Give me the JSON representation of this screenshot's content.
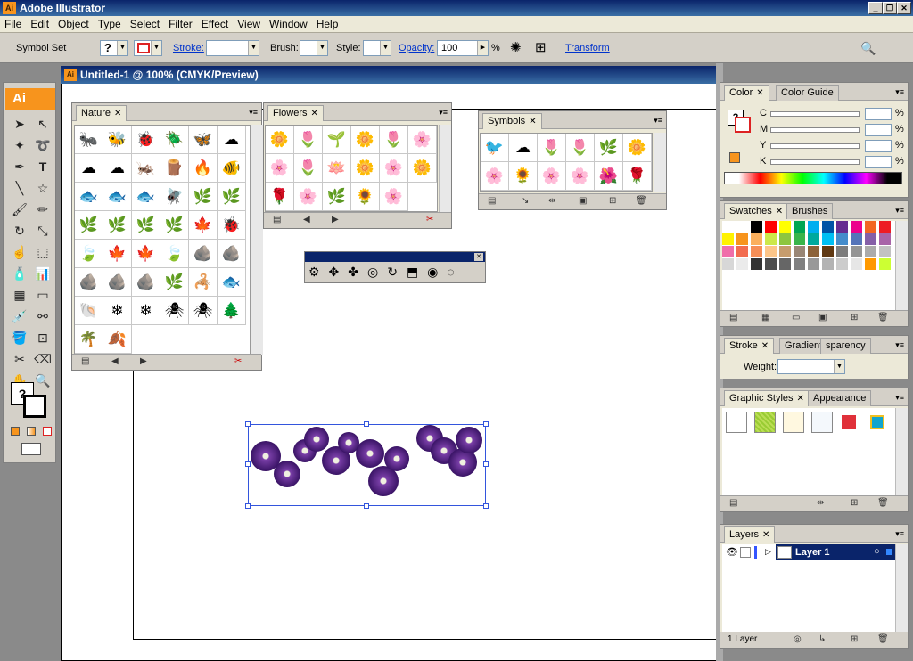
{
  "app": {
    "title": "Adobe Illustrator",
    "logo": "Ai",
    "win_min": "_",
    "win_max": "❐",
    "win_close": "✕"
  },
  "menus": [
    "File",
    "Edit",
    "Object",
    "Type",
    "Select",
    "Filter",
    "Effect",
    "View",
    "Window",
    "Help"
  ],
  "control": {
    "selection": "Symbol Set",
    "stroke_label": "Stroke:",
    "brush_label": "Brush:",
    "style_label": "Style:",
    "opacity_label": "Opacity:",
    "opacity_value": "100",
    "opacity_unit": "%",
    "transform_label": "Transform"
  },
  "document": {
    "title": "Untitled-1 @ 100% (CMYK/Preview)"
  },
  "nature": {
    "tab": "Nature",
    "icons": [
      "🐜",
      "🐝",
      "🐞",
      "🪲",
      "🦋",
      "☁",
      "☁",
      "☁",
      "🦗",
      "🪵",
      "🔥",
      "🐠",
      "🐟",
      "🐟",
      "🐟",
      "🪰",
      "🌿",
      "🌿",
      "🌿",
      "🌿",
      "🌿",
      "🌿",
      "🍁",
      "🐞",
      "🍃",
      "🍁",
      "🍁",
      "🍃",
      "🪨",
      "🪨",
      "🪨",
      "🪨",
      "🪨",
      "🌿",
      "🦂",
      "🐟",
      "🐚",
      "❄",
      "❄",
      "🕷",
      "🕷",
      "🌲",
      "🌴",
      "🍂"
    ]
  },
  "flowers": {
    "tab": "Flowers",
    "icons": [
      "🌼",
      "🌷",
      "🌱",
      "🌼",
      "🌷",
      "🌸",
      "🌸",
      "🌷",
      "🪷",
      "🌼",
      "🌸",
      "🌼",
      "🌹",
      "🌸",
      "🌿",
      "🌻",
      "🌸"
    ]
  },
  "symbols": {
    "tab": "Symbols",
    "icons": [
      "🐦",
      "☁",
      "🌷",
      "🌷",
      "🌿",
      "🌼",
      "🌸",
      "🌻",
      "🌸",
      "🌸",
      "🌺",
      "🌹"
    ]
  },
  "color": {
    "tab1": "Color",
    "tab2": "Color Guide",
    "labels": [
      "C",
      "M",
      "Y",
      "K"
    ],
    "unit": "%"
  },
  "swatches": {
    "tab1": "Swatches",
    "tab2": "Brushes",
    "colors": [
      "#ffffff",
      "#ffffff",
      "#000000",
      "#ff0000",
      "#ffff00",
      "#00a651",
      "#00aeef",
      "#0054a6",
      "#662d91",
      "#ec008c",
      "#f26522",
      "#ed1c24",
      "#fff200",
      "#f7941d",
      "#fbaf5d",
      "#cce84a",
      "#8dc63f",
      "#39b54a",
      "#00a99d",
      "#00bff3",
      "#448ccb",
      "#5574b9",
      "#855fa8",
      "#a864a8",
      "#f06eaa",
      "#f26c4f",
      "#f68e56",
      "#fdc689",
      "#c69c6d",
      "#998675",
      "#8c6239",
      "#603913",
      "#7d7d7d",
      "#959595",
      "#ababab",
      "#c2c2c2",
      "#d7d7d7",
      "#ebebeb",
      "#333333",
      "#4d4d4d",
      "#666666",
      "#808080",
      "#999999",
      "#b3b3b3",
      "#cccccc",
      "#e6e6e6",
      "#ff9900",
      "#ccff33"
    ]
  },
  "stroke": {
    "tab1": "Stroke",
    "tab2": "Gradient",
    "tab3": "sparency",
    "weight_label": "Weight:"
  },
  "graphic_styles": {
    "tab1": "Graphic Styles",
    "tab2": "Appearance"
  },
  "layers": {
    "tab": "Layers",
    "layer_name": "Layer 1",
    "count": "1 Layer"
  }
}
